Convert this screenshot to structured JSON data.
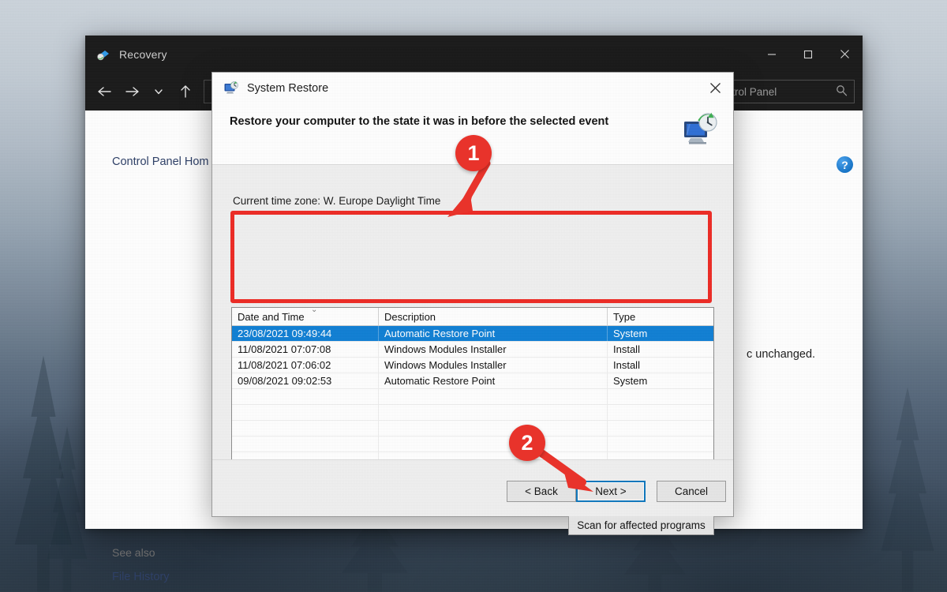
{
  "desktop": {
    "wallpaper_name": "misty-forest-wallpaper"
  },
  "recovery_window": {
    "title": "Recovery",
    "icon": "recovery-app-icon",
    "window_buttons": {
      "minimize": "minimize-icon",
      "maximize": "maximize-icon",
      "close": "close-icon"
    },
    "toolbar": {
      "back": "back-arrow-icon",
      "forward": "forward-arrow-icon",
      "recent": "chevron-down-icon",
      "up": "up-arrow-icon",
      "address_icon": "control-panel-icon",
      "search_placeholder": "rch Control Panel",
      "search_icon": "search-icon"
    },
    "sidebar": {
      "control_panel_home": "Control Panel Hom",
      "see_also_label": "See also",
      "file_history": "File History"
    },
    "content": {
      "truncated_text": "c unchanged.",
      "help_icon": "help-icon",
      "help_glyph": "?"
    }
  },
  "system_restore_dialog": {
    "title": "System Restore",
    "title_icon": "system-restore-icon",
    "close_label": "close-icon",
    "heading": "Restore your computer to the state it was in before the selected event",
    "header_icon": "system-restore-large-icon",
    "time_zone": "Current time zone: W. Europe Daylight Time",
    "table": {
      "columns": [
        "Date and Time",
        "Description",
        "Type"
      ],
      "sort_indicator": "sort-ascending-caret",
      "rows": [
        {
          "date": "23/08/2021 09:49:44",
          "description": "Automatic Restore Point",
          "type": "System",
          "selected": true
        },
        {
          "date": "11/08/2021 07:07:08",
          "description": "Windows Modules Installer",
          "type": "Install",
          "selected": false
        },
        {
          "date": "11/08/2021 07:06:02",
          "description": "Windows Modules Installer",
          "type": "Install",
          "selected": false
        },
        {
          "date": "09/08/2021 09:02:53",
          "description": "Automatic Restore Point",
          "type": "System",
          "selected": false
        }
      ],
      "empty_row_count": 8
    },
    "scan_button": "Scan for affected programs",
    "buttons": {
      "back": "< Back",
      "next": "Next >",
      "cancel": "Cancel"
    }
  },
  "annotations": {
    "color": "#e8332b",
    "badges": [
      {
        "label": "1",
        "target": "restore-point-table"
      },
      {
        "label": "2",
        "target": "next-button"
      }
    ],
    "highlight_boxes": [
      {
        "target": "restore-point-table"
      }
    ]
  }
}
